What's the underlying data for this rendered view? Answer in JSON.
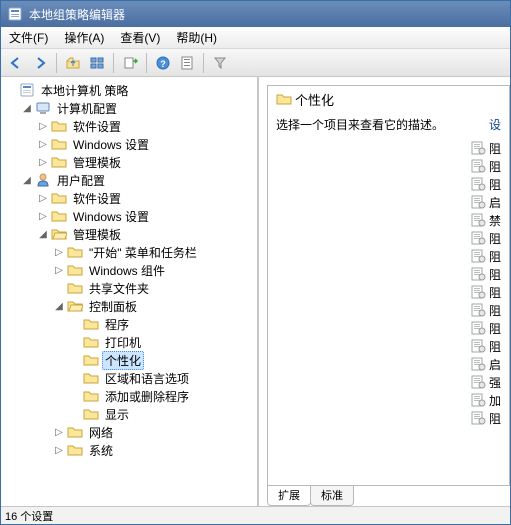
{
  "window": {
    "title": "本地组策略编辑器"
  },
  "menu": {
    "file": "文件(F)",
    "action": "操作(A)",
    "view": "查看(V)",
    "help": "帮助(H)"
  },
  "toolbar_icons": [
    "back",
    "forward",
    "up",
    "views",
    "export",
    "help",
    "properties",
    "filter"
  ],
  "tree": {
    "root": "本地计算机 策略",
    "computer": "计算机配置",
    "comp_sw": "软件设置",
    "comp_win": "Windows 设置",
    "comp_adm": "管理模板",
    "user": "用户配置",
    "user_sw": "软件设置",
    "user_win": "Windows 设置",
    "user_adm": "管理模板",
    "start_taskbar": "\"开始\" 菜单和任务栏",
    "win_comp": "Windows 组件",
    "shared": "共享文件夹",
    "cpl": "控制面板",
    "programs": "程序",
    "printers": "打印机",
    "personalization": "个性化",
    "region": "区域和语言选项",
    "addremove": "添加或删除程序",
    "display": "显示",
    "network": "网络",
    "system": "系统"
  },
  "right": {
    "heading": "个性化",
    "desc": "选择一个项目来查看它的描述。",
    "setting_header": "设",
    "items": [
      "阻",
      "阻",
      "阻",
      "启",
      "禁",
      "阻",
      "阻",
      "阻",
      "阻",
      "阻",
      "阻",
      "阻",
      "启",
      "强",
      "加",
      "阻"
    ]
  },
  "tabs": {
    "extended": "扩展",
    "standard": "标准"
  },
  "status": "16 个设置"
}
